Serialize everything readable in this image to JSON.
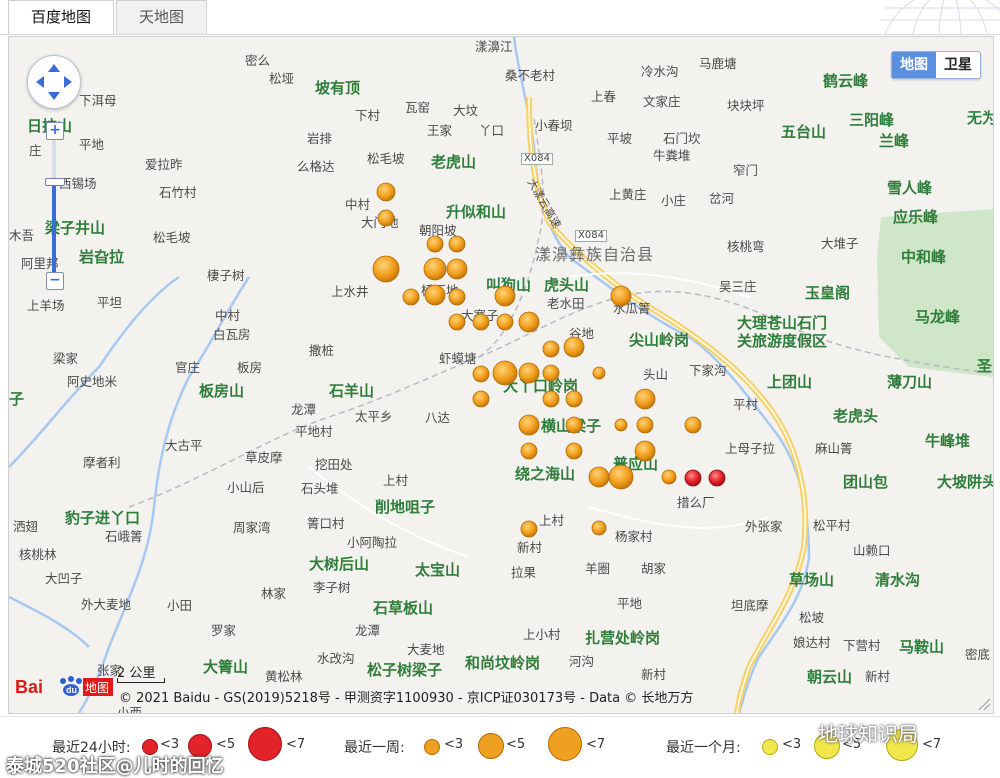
{
  "tabs": {
    "baidu": "百度地图",
    "tianditu": "天地图"
  },
  "map_type": {
    "map": "地图",
    "satellite": "卫星"
  },
  "controls": {
    "zoom_in": "+",
    "zoom_out": "−"
  },
  "region": {
    "county": "漾濞彝族自治县",
    "scenic_area": [
      "大理苍山石门",
      "关旅游度假区"
    ]
  },
  "roads": [
    "X084",
    "X084"
  ],
  "river": "漾濞江",
  "expressway_text": "大漾云高速",
  "mountains": [
    "坡有顶",
    "老虎山",
    "升似和山",
    "叫狗山",
    "虎头山",
    "尖山岭岗",
    "岩旮拉",
    "梁子井山",
    "日拉山",
    "板房山",
    "石羊山",
    "大丫口岭岗",
    "横山梁子",
    "绕之海山",
    "普应山",
    "豹子进丫口",
    "削地咀子",
    "大树后山",
    "太宝山",
    "石草板山",
    "扎营处岭岗",
    "和尚坟岭岗",
    "松子树梁子",
    "大箐山",
    "朝云山",
    "草场山",
    "清水沟",
    "团山包",
    "大坡阱头",
    "牛峰堆",
    "薄刀山",
    "上团山",
    "老虎头",
    "玉皇阁",
    "马龙峰",
    "中和峰",
    "应乐峰",
    "雪人峰",
    "五台山",
    "三阳峰",
    "兰峰",
    "鹤云峰",
    "无为",
    "马鞍山",
    "圣",
    "子"
  ],
  "villages": [
    "密么",
    "松垭",
    "下洱母",
    "平地",
    "庄",
    "爱拉昨",
    "西锡场",
    "石竹村",
    "木吾",
    "阿里邦",
    "上羊场",
    "平坦",
    "梁家",
    "阿史地米",
    "官庄",
    "板房",
    "白瓦房",
    "中村",
    "棲子树",
    "松毛坡",
    "下村",
    "瓦窑",
    "大坟",
    "王家",
    "丫口",
    "岩排",
    "松毛坡",
    "么格达",
    "中村",
    "大门地",
    "朝阳坡",
    "上水井",
    "桥下地",
    "大寨子",
    "老水田",
    "水瓜箐",
    "谷地",
    "虾蟆塘",
    "撒桩",
    "龙潭",
    "平地村",
    "太平乡",
    "八达",
    "大古平",
    "摩者利",
    "草皮摩",
    "挖田处",
    "小山后",
    "石头堆",
    "上村",
    "周家湾",
    "箐口村",
    "小阿陶拉",
    "李子树",
    "林家",
    "罗家",
    "小田",
    "龙潭",
    "大麦地",
    "水改沟",
    "黄松林",
    "河沟",
    "新村",
    "羊圈",
    "胡家",
    "平地",
    "上小村",
    "拉果",
    "新村",
    "杨家村",
    "上村",
    "措么厂",
    "上母子拉",
    "麻山箐",
    "外张家",
    "松平村",
    "山赖口",
    "坦底摩",
    "松坡",
    "娘达村",
    "下营村",
    "新村",
    "密底",
    "平村",
    "头山",
    "下家沟",
    "吴三庄",
    "核桃弯",
    "大堆子",
    "窄门",
    "岔河",
    "小庄",
    "上黄庄",
    "牛粪堆",
    "石门坎",
    "平坡",
    "小春坝",
    "上春",
    "文家庄",
    "冷水沟",
    "马鹿塘",
    "块块坪",
    "桑不老村",
    "外大麦地",
    "大凹子",
    "核桃林",
    "洒翅",
    "石峨箐",
    "小西",
    "张家"
  ],
  "scale": "2 公里",
  "logo": {
    "text": "Bai",
    "sub": "地图"
  },
  "copyright": "© 2021 Baidu - GS(2019)5218号 - 甲测资字1100930 - 京ICP证030173号 - Data © 长地万方",
  "legend": {
    "last24h": "最近24小时:",
    "lastweek": "最近一周:",
    "lastmonth": "最近一个月:",
    "m3": "<3",
    "m5": "<5",
    "m7": "<7"
  },
  "colors": {
    "recent24h": "#e2232a",
    "recentweek": "#f0a020",
    "recentmonth": "#f1e64a",
    "water": "#a7c8f0",
    "forest": "#cfe6c8",
    "road_major": "#f7d36b"
  },
  "watermarks": {
    "brand": "地球知识局",
    "forum": "泰城520社区@儿时的回忆"
  }
}
